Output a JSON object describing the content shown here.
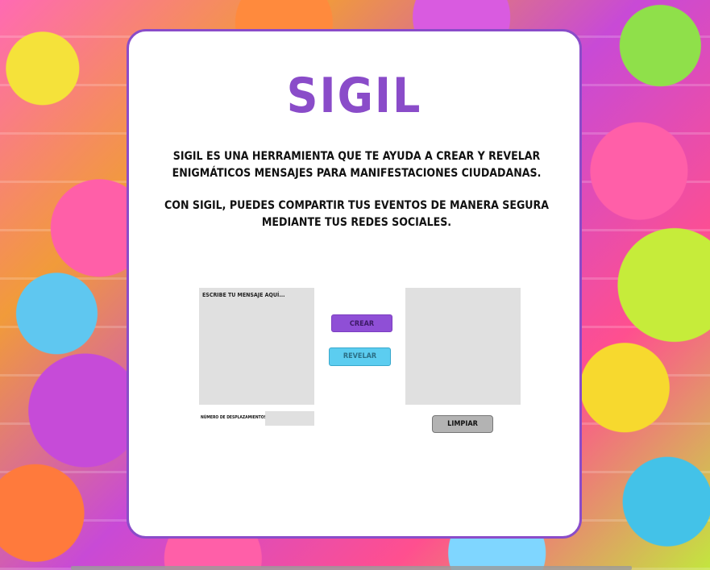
{
  "app": {
    "title": "SIGIL"
  },
  "description": {
    "paragraph1": "SIGIL ES UNA HERRAMIENTA QUE TE AYUDA A CREAR Y REVELAR ENIGMÁTICOS MENSAJES PARA MANIFESTACIONES CIUDADANAS.",
    "paragraph2": "CON SIGIL, PUEDES COMPARTIR TUS EVENTOS DE MANERA SEGURA MEDIANTE TUS REDES SOCIALES."
  },
  "message_input": {
    "placeholder": "ESCRIBE TU MENSAJE AQUÍ...",
    "value": ""
  },
  "output": {
    "value": ""
  },
  "buttons": {
    "create": "CREAR",
    "reveal": "REVELAR",
    "clear": "LIMPIAR"
  },
  "shift": {
    "label": "NÚMERO DE DESPLAZAMIENTOS",
    "value": ""
  },
  "colors": {
    "accent": "#8a4cc9",
    "create_button": "#8f4fd6",
    "reveal_button": "#5ccdf0",
    "clear_button": "#b3b3b3",
    "field_background": "#e0e0e0"
  }
}
